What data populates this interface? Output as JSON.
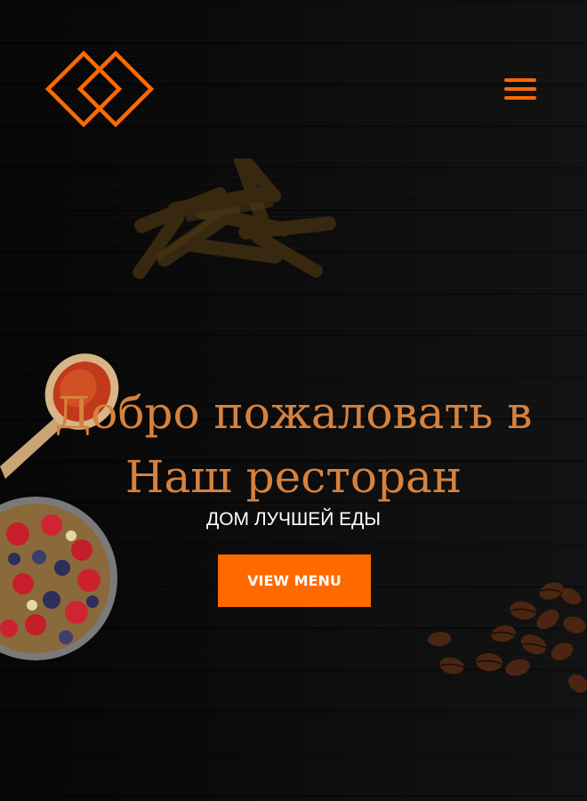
{
  "header": {
    "logo_icon": "interlocking-diamonds-logo",
    "menu_icon": "hamburger-menu-icon"
  },
  "hero": {
    "title_line1": "Добро пожаловать в",
    "title_line2": "Наш ресторан",
    "subtitle": "ДОМ ЛУЧШЕЙ ЕДЫ",
    "cta_label": "VIEW MENU"
  },
  "decorations": [
    "french-fries-image",
    "spice-spoon-image",
    "berry-bowl-image",
    "coffee-beans-image"
  ],
  "colors": {
    "accent": "#ff6a00",
    "title": "#d6823e",
    "background": "#0a0a0a",
    "subtitle": "#ffffff"
  }
}
